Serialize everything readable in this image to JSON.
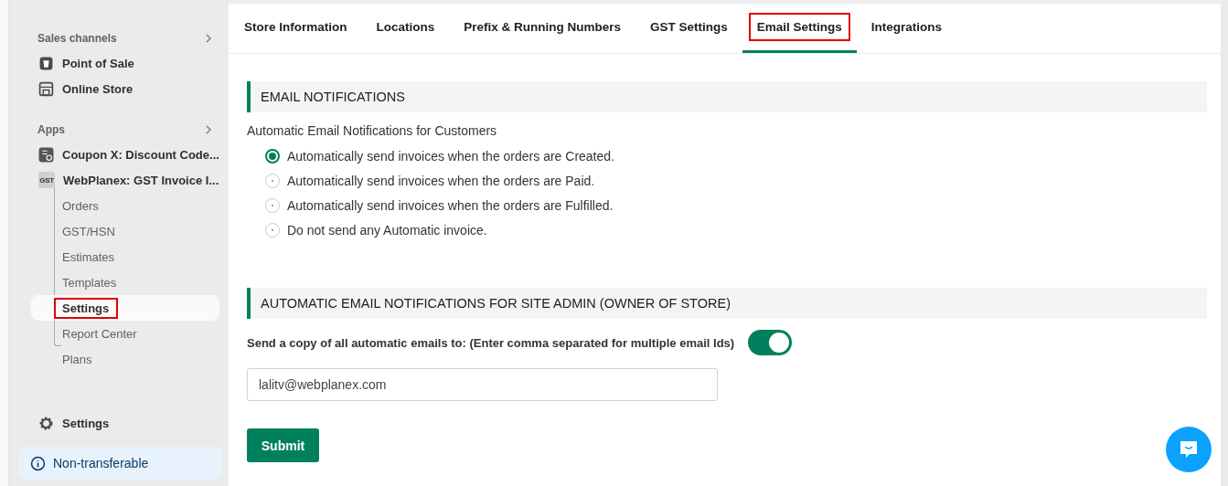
{
  "sidebar": {
    "sections": [
      {
        "title": "Sales channels",
        "items": [
          {
            "label": "Point of Sale"
          },
          {
            "label": "Online Store"
          }
        ]
      },
      {
        "title": "Apps",
        "items": [
          {
            "label": "Coupon X: Discount Code..."
          },
          {
            "label": "WebPlanex: GST Invoice I...",
            "icon_text": "GST",
            "children": [
              {
                "label": "Orders",
                "selected": false,
                "highlighted": false
              },
              {
                "label": "GST/HSN",
                "selected": false,
                "highlighted": false
              },
              {
                "label": "Estimates",
                "selected": false,
                "highlighted": false
              },
              {
                "label": "Templates",
                "selected": false,
                "highlighted": false
              },
              {
                "label": "Settings",
                "selected": true,
                "highlighted": true
              },
              {
                "label": "Report Center",
                "selected": false,
                "highlighted": false
              },
              {
                "label": "Plans",
                "selected": false,
                "highlighted": false
              }
            ]
          }
        ]
      }
    ],
    "settings": "Settings",
    "notice": "Non-transferable"
  },
  "tabs": [
    {
      "label": "Store Information",
      "selected": false,
      "highlighted": false
    },
    {
      "label": "Locations",
      "selected": false,
      "highlighted": false
    },
    {
      "label": "Prefix & Running Numbers",
      "selected": false,
      "highlighted": false
    },
    {
      "label": "GST Settings",
      "selected": false,
      "highlighted": false
    },
    {
      "label": "Email Settings",
      "selected": true,
      "highlighted": true
    },
    {
      "label": "Integrations",
      "selected": false,
      "highlighted": false
    }
  ],
  "customer_section": {
    "title": "EMAIL NOTIFICATIONS",
    "subtitle": "Automatic Email Notifications for Customers",
    "options": [
      {
        "label": "Automatically send invoices when the orders are Created.",
        "selected": true
      },
      {
        "label": "Automatically send invoices when the orders are Paid.",
        "selected": false
      },
      {
        "label": "Automatically send invoices when the orders are Fulfilled.",
        "selected": false
      },
      {
        "label": "Do not send any Automatic invoice.",
        "selected": false
      }
    ]
  },
  "admin_section": {
    "title": "AUTOMATIC EMAIL NOTIFICATIONS FOR SITE ADMIN (OWNER OF STORE)",
    "copy_label": "Send a copy of all automatic emails to: (Enter comma separated for multiple email Ids)",
    "copy_on": true,
    "email": "lalitv@webplanex.com",
    "submit": "Submit"
  }
}
